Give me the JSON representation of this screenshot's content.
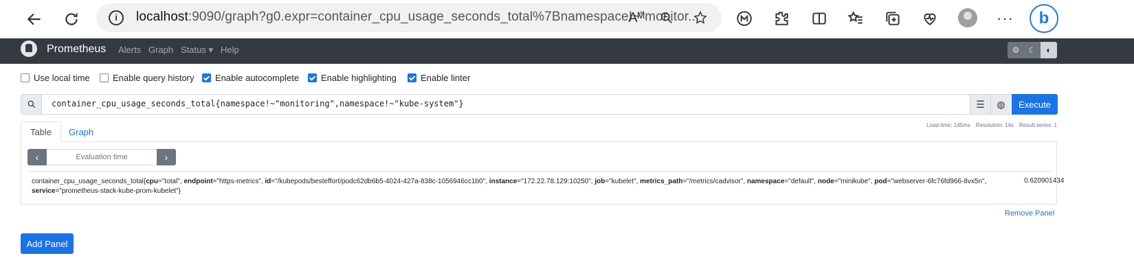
{
  "browser": {
    "url_host": "localhost",
    "url_rest": ":9090/graph?g0.expr=container_cpu_usage_seconds_total%7Bnamespace!~\"monitor...",
    "read_aloud_icon": "Aᴹ"
  },
  "navbar": {
    "brand": "Prometheus",
    "links": [
      "Alerts",
      "Graph",
      "Status",
      "Help"
    ],
    "status_caret": "▾",
    "theme_icons": [
      "⚙",
      "☾",
      "◐"
    ]
  },
  "options": [
    {
      "label": "Use local time",
      "checked": false
    },
    {
      "label": "Enable query history",
      "checked": false
    },
    {
      "label": "Enable autocomplete",
      "checked": true
    },
    {
      "label": "Enable highlighting",
      "checked": true
    },
    {
      "label": "Enable linter",
      "checked": true
    }
  ],
  "expression": {
    "value": "container_cpu_usage_seconds_total{namespace!~\"monitoring\",namespace!~\"kube-system\"}",
    "execute_label": "Execute"
  },
  "load_info": {
    "load_time": "Load time: 145ms",
    "resolution": "Resolution: 14s",
    "result_series": "Result series: 1"
  },
  "tabs": {
    "table": "Table",
    "graph": "Graph"
  },
  "eval": {
    "prev": "‹",
    "next": "›",
    "placeholder": "Evaluation time"
  },
  "result": {
    "metric": "container_cpu_usage_seconds_total",
    "labels": [
      {
        "k": "cpu",
        "v": "\"total\""
      },
      {
        "k": "endpoint",
        "v": "\"https-metrics\""
      },
      {
        "k": "id",
        "v": "\"/kubepods/besteffort/podc62db6b5-4024-427a-838c-1056946cc1b0\""
      },
      {
        "k": "instance",
        "v": "\"172.22.78.129:10250\""
      },
      {
        "k": "job",
        "v": "\"kubelet\""
      },
      {
        "k": "metrics_path",
        "v": "\"/metrics/cadvisor\""
      },
      {
        "k": "namespace",
        "v": "\"default\""
      },
      {
        "k": "node",
        "v": "\"minikube\""
      },
      {
        "k": "pod",
        "v": "\"webserver-6fc76fd966-8vx5n\""
      },
      {
        "k": "service",
        "v": "\"prometheus-stack-kube-prom-kubelet\""
      }
    ],
    "value": "0.620901434"
  },
  "remove_panel": "Remove Panel",
  "add_panel": "Add Panel",
  "colors": {
    "navbar": "#343a40",
    "accent": "#1a73e8"
  }
}
